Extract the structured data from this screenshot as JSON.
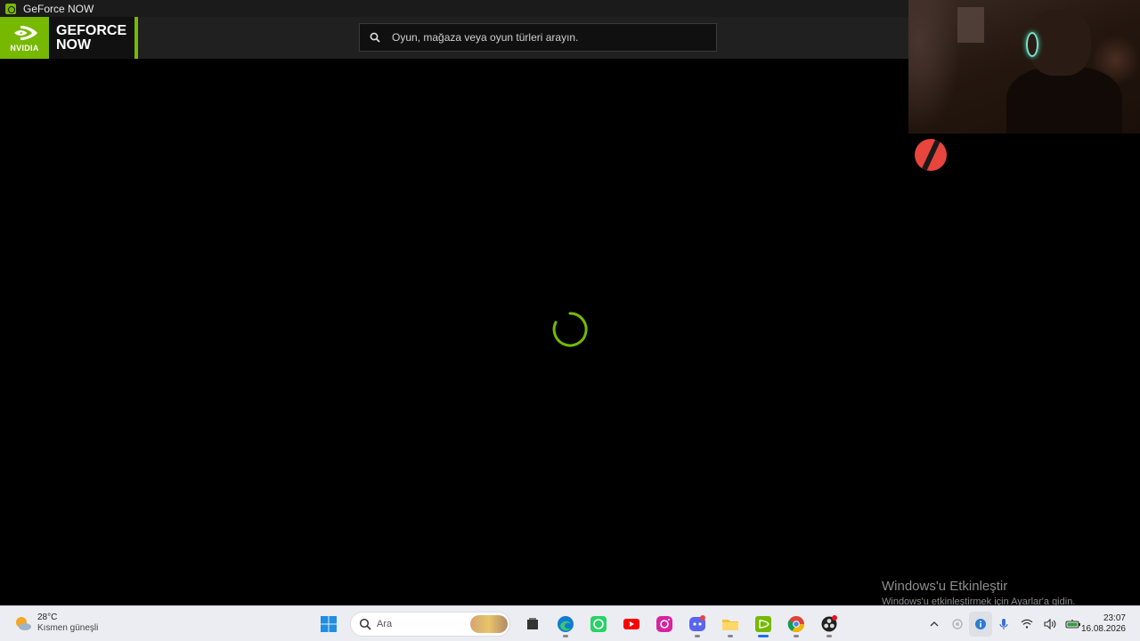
{
  "window": {
    "title": "GeForce NOW"
  },
  "header": {
    "brand_vendor": "NVIDIA",
    "brand_line1": "GEFORCE",
    "brand_line2": "NOW",
    "search_placeholder": "Oyun, mağaza veya oyun türleri arayın.",
    "accent_color": "#76b900"
  },
  "main": {
    "state": "loading",
    "spinner_color": "#76b900"
  },
  "watermark": {
    "title": "Windows'u Etkinleştir",
    "subtitle": "Windows'u etkinleştirmek için Ayarlar'a gidin."
  },
  "taskbar": {
    "weather": {
      "temp": "28°C",
      "condition": "Kısmen güneşli",
      "icon": "partly-sunny-icon"
    },
    "search_label": "Ara",
    "apps": [
      {
        "name": "start",
        "icon": "windows-logo-icon"
      },
      {
        "name": "task-view",
        "icon": "task-view-icon"
      },
      {
        "name": "edge",
        "icon": "edge-icon"
      },
      {
        "name": "whatsapp",
        "icon": "whatsapp-icon"
      },
      {
        "name": "youtube",
        "icon": "youtube-icon"
      },
      {
        "name": "instagram",
        "icon": "instagram-icon"
      },
      {
        "name": "discord",
        "icon": "discord-icon"
      },
      {
        "name": "file-explorer",
        "icon": "folder-icon"
      },
      {
        "name": "geforce-now",
        "icon": "nvidia-icon",
        "active": true
      },
      {
        "name": "chrome",
        "icon": "chrome-icon"
      },
      {
        "name": "obs",
        "icon": "obs-icon"
      }
    ],
    "tray": {
      "icons": [
        "chevron-up-icon",
        "security-icon",
        "network-status-icon",
        "microphone-icon",
        "wifi-icon",
        "volume-icon",
        "battery-icon"
      ]
    },
    "clock": {
      "time": "23:07",
      "date": "16.08.2026"
    }
  }
}
